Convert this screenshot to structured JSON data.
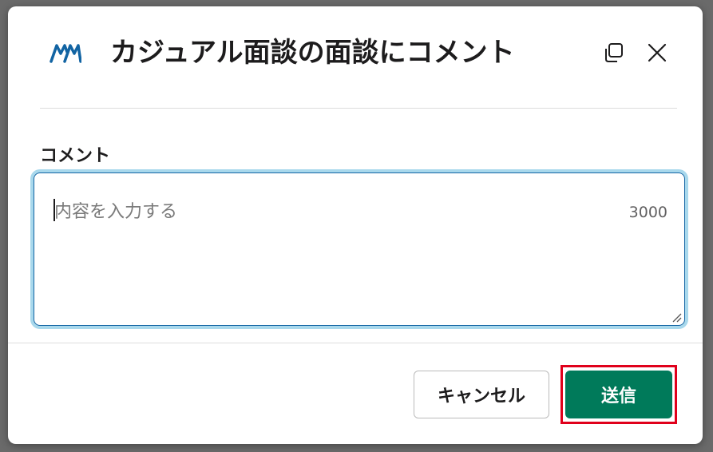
{
  "modal": {
    "title": "カジュアル面談の面談にコメント",
    "copy_icon": "copy-icon",
    "close_icon": "close-icon",
    "logo": "app-logo"
  },
  "form": {
    "label": "コメント",
    "placeholder": "内容を入力する",
    "value": "",
    "char_limit": "3000"
  },
  "footer": {
    "cancel_label": "キャンセル",
    "submit_label": "送信"
  },
  "colors": {
    "submit": "#007a5a",
    "highlight": "#e0001b",
    "focus_ring": "#a8d8ec",
    "logo": "#1264a3"
  }
}
